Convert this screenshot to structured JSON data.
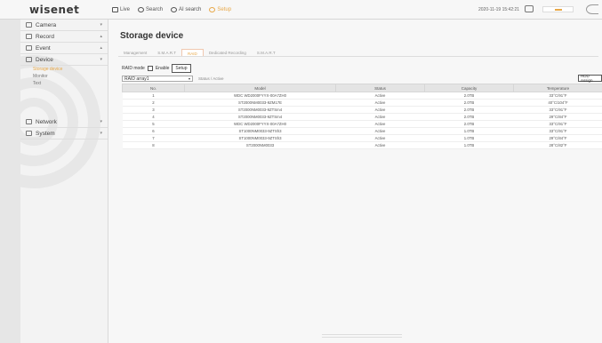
{
  "brand": "wisenet",
  "topnav": [
    {
      "label": "Live",
      "icon": "monitor-icon",
      "active": false
    },
    {
      "label": "Search",
      "icon": "search-icon",
      "active": false
    },
    {
      "label": "AI search",
      "icon": "ai-search-icon",
      "active": false
    },
    {
      "label": "Setup",
      "icon": "gear-icon",
      "active": true
    }
  ],
  "datetime": "2020-11-19 15:42:21",
  "sidebar": {
    "items": [
      {
        "label": "Camera",
        "icon": "camera-icon"
      },
      {
        "label": "Record",
        "icon": "record-icon"
      },
      {
        "label": "Event",
        "icon": "event-icon"
      },
      {
        "label": "Device",
        "icon": "device-icon"
      }
    ],
    "subitems": [
      {
        "label": "Storage device",
        "active": true
      },
      {
        "label": "Monitor",
        "active": false
      },
      {
        "label": "Text",
        "active": false
      }
    ],
    "bottom_items": [
      {
        "label": "Network",
        "icon": "network-icon"
      },
      {
        "label": "System",
        "icon": "system-icon"
      }
    ]
  },
  "main": {
    "title": "Storage device",
    "tabs": [
      {
        "label": "Management",
        "active": false
      },
      {
        "label": "S.M.A.R.T",
        "active": false
      },
      {
        "label": "RAID",
        "active": true
      },
      {
        "label": "Dedicated Recording",
        "active": false
      },
      {
        "label": "S.M.A.R.T",
        "active": false
      }
    ],
    "raid_mode_label": "RAID mode",
    "enable_label": "Enable",
    "setup_button": "Setup",
    "array_select": "RAID array1",
    "array_status": "Status / Active",
    "hdd_button": "HDD Assign",
    "columns": [
      "No.",
      "Model",
      "Status",
      "Capacity",
      "Temperature"
    ],
    "rows": [
      [
        "1",
        "WDC WD2000FYYX-00A7ZH0",
        "Active",
        "2.0TB",
        "33°C/91°F"
      ],
      [
        "2",
        "ST2000NM0033-9ZM17E",
        "Active",
        "2.0TB",
        "40°C/104°F"
      ],
      [
        "3",
        "ST2000NM0033-9ZTSm4",
        "Active",
        "2.0TB",
        "33°C/91°F"
      ],
      [
        "4",
        "ST2000NM0033-9ZTSm4",
        "Active",
        "2.0TB",
        "29°C/84°F"
      ],
      [
        "5",
        "WDC WD2000FYYX-00A7ZH0",
        "Active",
        "2.0TB",
        "33°C/91°F"
      ],
      [
        "6",
        "ST1000NM0033-9ZTSh3",
        "Active",
        "1.0TB",
        "33°C/91°F"
      ],
      [
        "7",
        "ST1000NM0033-9ZTSh3",
        "Active",
        "1.0TB",
        "29°C/84°F"
      ],
      [
        "8",
        "ST2000NM0033",
        "Active",
        "1.0TB",
        "28°C/82°F"
      ]
    ]
  }
}
